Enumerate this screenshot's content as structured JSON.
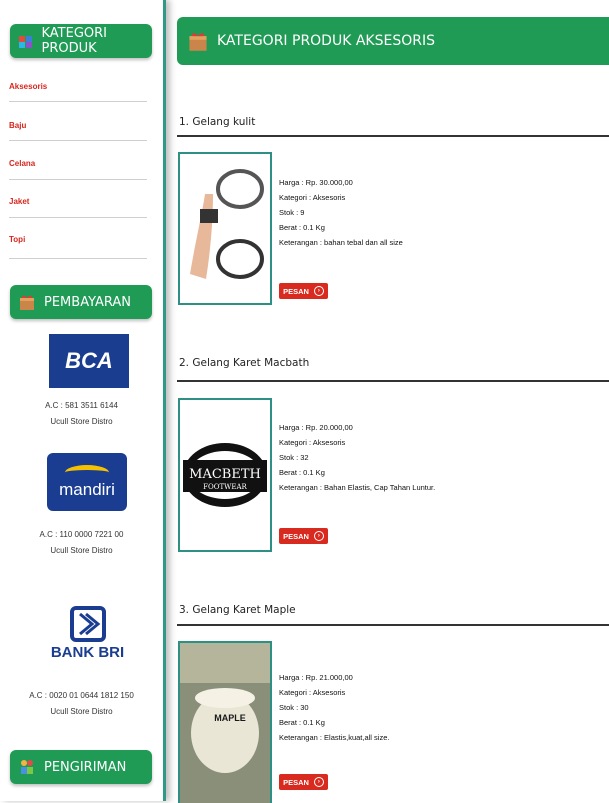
{
  "sidebar": {
    "categories_title": "KATEGORI PRODUK",
    "categories": [
      "Aksesoris",
      "Baju",
      "Celana",
      "Jaket",
      "Topi"
    ],
    "payment_title": "PEMBAYARAN",
    "banks": [
      {
        "logo_text": "BCA",
        "account": "A.C : 581 3511 6144",
        "owner": "Ucull Store Distro"
      },
      {
        "logo_text": "mandiri",
        "account": "A.C : 110 0000 7221 00",
        "owner": "Ucull Store Distro"
      },
      {
        "logo_text": "BANK BRI",
        "account": "A.C : 0020 01 0644 1812 150",
        "owner": "Ucull Store Distro"
      }
    ],
    "shipping_title": "PENGIRIMAN"
  },
  "main": {
    "title": "KATEGORI PRODUK AKSESORIS",
    "products": [
      {
        "title": "1. Gelang kulit",
        "harga": "Harga : Rp. 30.000,00",
        "kategori": "Kategori : Aksesoris",
        "stok": "Stok : 9",
        "berat": "Berat : 0.1 Kg",
        "keterangan": "Keterangan : bahan tebal dan all size",
        "button": "PESAN"
      },
      {
        "title": "2. Gelang Karet Macbath",
        "harga": "Harga : Rp. 20.000,00",
        "kategori": "Kategori : Aksesoris",
        "stok": "Stok : 32",
        "berat": "Berat : 0.1 Kg",
        "keterangan": "Keterangan : Bahan Elastis, Cap Tahan Luntur.",
        "button": "PESAN",
        "image_text": "MACBETH",
        "image_subtext": "FOOTWEAR"
      },
      {
        "title": "3. Gelang Karet Maple",
        "harga": "Harga : Rp. 21.000,00",
        "kategori": "Kategori : Aksesoris",
        "stok": "Stok : 30",
        "berat": "Berat : 0.1 Kg",
        "keterangan": "Keterangan : Elastis,kuat,all size.",
        "button": "PESAN",
        "image_text": "MAPLE"
      }
    ]
  },
  "colors": {
    "accent_green": "#1f9b55",
    "button_red": "#d92a1f",
    "link_red": "#d7261d",
    "sidebar_border": "#2e9a86"
  },
  "icons": [
    "box-icon",
    "gift-icon",
    "arrow-circle-icon",
    "people-icon"
  ]
}
